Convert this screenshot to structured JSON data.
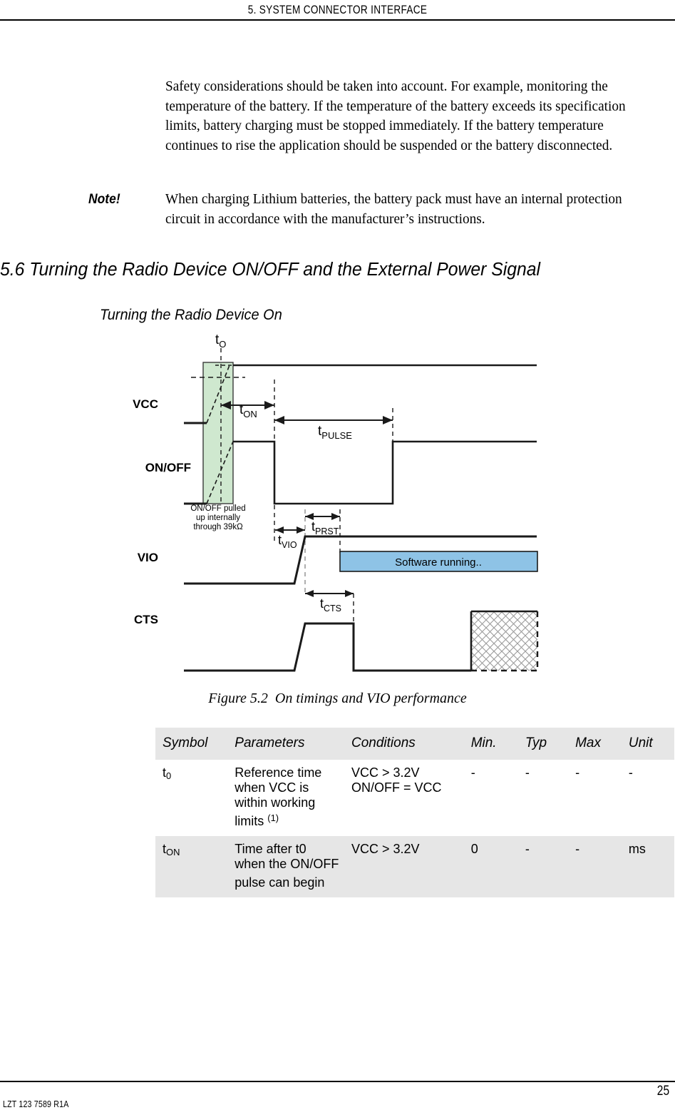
{
  "header": {
    "title": "5. SYSTEM CONNECTOR INTERFACE"
  },
  "body": {
    "paragraph1": "Safety considerations should be taken into account. For example, monitoring the temperature of the battery. If the temperature of the battery exceeds its specification limits, battery charging must be stopped immediately. If the battery temperature continues to rise the application should be suspended or the battery disconnected.",
    "note_label": "Note!",
    "note_text": "When charging Lithium batteries, the battery pack must have an internal protection circuit in accordance with the manufacturer’s instructions."
  },
  "section": {
    "heading": "5.6 Turning the Radio Device ON/OFF and the External Power Signal",
    "subheading": "Turning the Radio Device On"
  },
  "figure": {
    "caption_number": "Figure 5.2",
    "caption_text": "On timings and VIO performance",
    "signals": [
      {
        "name": "VCC"
      },
      {
        "name": "ON/OFF"
      },
      {
        "name": "VIO"
      },
      {
        "name": "CTS"
      }
    ],
    "annotations": {
      "t0": "t",
      "t0_sub": "O",
      "ton": "t",
      "ton_sub": "ON",
      "tpulse": "t",
      "tpulse_sub": "PULSE",
      "tvio": "t",
      "tvio_sub": "VIO",
      "tprst": "t",
      "tprst_sub": "PRST",
      "tcts": "t",
      "tcts_sub": "CTS",
      "pullup_line1": "ON/OFF pulled",
      "pullup_line2": "up internally",
      "pullup_line3": "through 39kΩ",
      "software_running": "Software running.."
    },
    "colors": {
      "band_green": "#cfe8cf",
      "band_border": "#3a3a3a",
      "software_blue": "#8ec3e6",
      "signal_line": "#1a1a1a"
    }
  },
  "table": {
    "headers": [
      "Symbol",
      "Parameters",
      "Conditions",
      "Min.",
      "Typ",
      "Max",
      "Unit"
    ],
    "rows": [
      {
        "symbol": "t",
        "symbol_sub": "0",
        "parameters": "Reference time when VCC is within working limits ",
        "parameters_sup": "(1)",
        "conditions_line1": "VCC > 3.2V",
        "conditions_line2": "ON/OFF = VCC",
        "min": "-",
        "typ": "-",
        "max": "-",
        "unit": "-",
        "shaded": false
      },
      {
        "symbol": "t",
        "symbol_sub": "ON",
        "parameters": "Time after t0 when the ON/OFF pulse can begin",
        "parameters_sup": "",
        "conditions_line1": "VCC > 3.2V",
        "conditions_line2": "",
        "min": "0",
        "typ": "-",
        "max": "-",
        "unit": "ms",
        "shaded": true
      }
    ]
  },
  "footer": {
    "page_number": "25",
    "document_id": "LZT 123 7589 R1A"
  }
}
